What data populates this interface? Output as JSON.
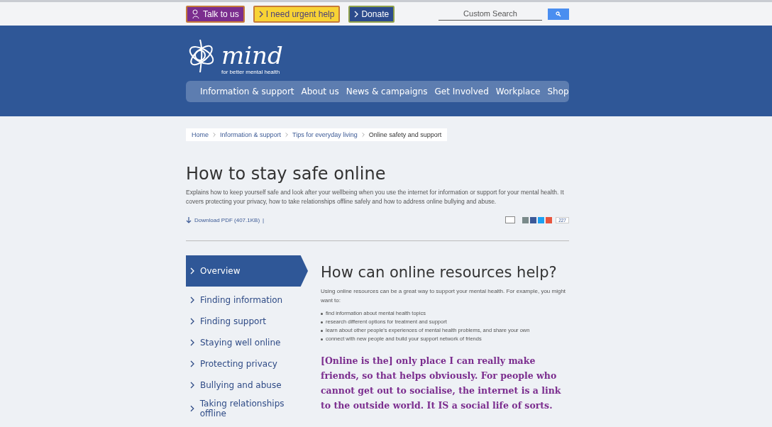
{
  "top_bar": {
    "buttons": [
      {
        "label": "Talk to us",
        "kind": "talk"
      },
      {
        "label": "I need urgent help",
        "kind": "urgent"
      },
      {
        "label": "Donate",
        "kind": "donate"
      }
    ],
    "search": {
      "placeholder": "Custom Search"
    }
  },
  "logo": {
    "name": "mind",
    "tagline": "for better mental health"
  },
  "nav": {
    "items": [
      "Information & support",
      "About us",
      "News & campaigns",
      "Get Involved",
      "Workplace",
      "Shop"
    ]
  },
  "breadcrumb": [
    {
      "label": "Home",
      "current": false
    },
    {
      "label": "Information & support",
      "current": false
    },
    {
      "label": "Tips for everyday living",
      "current": false
    },
    {
      "label": "Online safety and support",
      "current": true
    }
  ],
  "page": {
    "title": "How to stay safe online",
    "summary": "Explains how to keep yourself safe and look after your wellbeing when you use the internet for information or support for your mental health. It covers protecting your privacy, how to take relationships offline safely and how to address online bullying and abuse.",
    "download": "Download PDF (407.1KB)",
    "separator": "|",
    "share_count": "227"
  },
  "sidebar": {
    "items": [
      {
        "label": "Overview",
        "selected": true
      },
      {
        "label": "Finding information",
        "selected": false
      },
      {
        "label": "Finding support",
        "selected": false
      },
      {
        "label": "Staying well online",
        "selected": false
      },
      {
        "label": "Protecting privacy",
        "selected": false
      },
      {
        "label": "Bullying and abuse",
        "selected": false
      },
      {
        "label": "Taking relationships offline",
        "selected": false
      }
    ]
  },
  "content": {
    "heading": "How can online resources help?",
    "intro": "Using online resources can be a great way to support your mental health. For example, you might want to:",
    "bullets": [
      "find information about mental health topics",
      "research different options for treatment and support",
      "learn about other people's experiences of mental health problems, and share your own",
      "connect with new people and build your support network of friends"
    ],
    "quote": "[Online is the] only place I can really make friends, so that helps obviously. For people who cannot get out to socialise, the internet is a link to the outside world. It IS a social life of sorts."
  }
}
